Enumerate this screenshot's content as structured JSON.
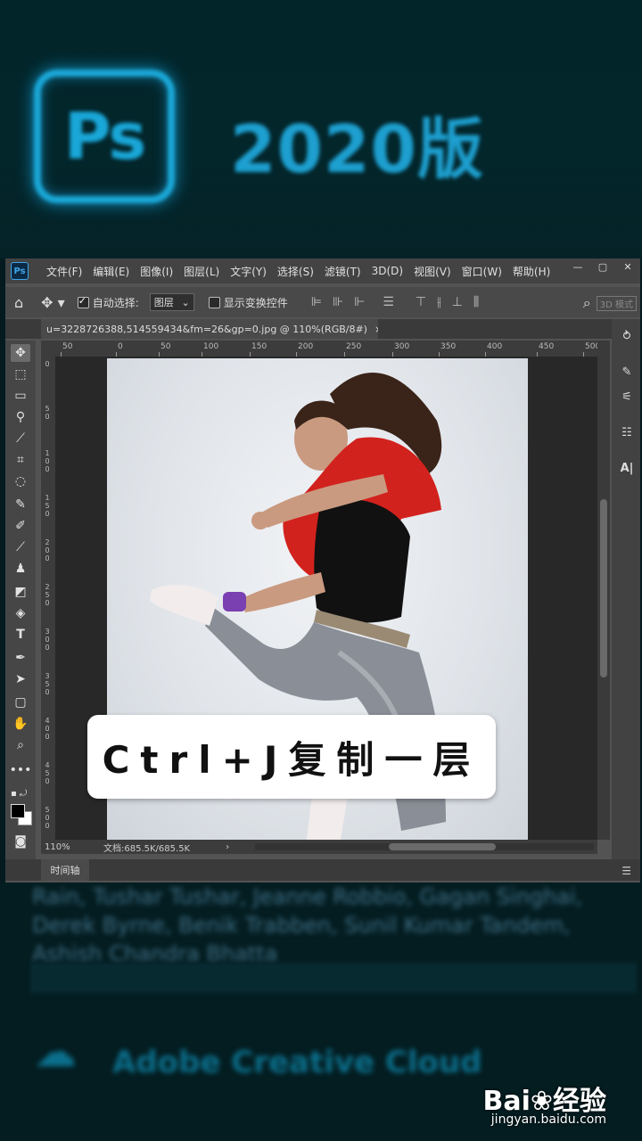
{
  "banner": {
    "logo_text": "Ps",
    "title": "2020版"
  },
  "menubar": {
    "app_icon": "Ps",
    "items": [
      "文件(F)",
      "编辑(E)",
      "图像(I)",
      "图层(L)",
      "文字(Y)",
      "选择(S)",
      "滤镜(T)",
      "3D(D)",
      "视图(V)",
      "窗口(W)",
      "帮助(H)"
    ],
    "window_controls": [
      "—",
      "▢",
      "✕"
    ]
  },
  "options_bar": {
    "auto_select_label": "自动选择:",
    "auto_select_checked": true,
    "layer_dropdown": "图层",
    "show_transform_label": "显示变换控件",
    "show_transform_checked": false,
    "mode_label": "3D 模式"
  },
  "document": {
    "tab_title": "u=3228726388,514559434&fm=26&gp=0.jpg @ 110%(RGB/8#)",
    "tab_close": "×",
    "zoom": "110%",
    "doc_size": "文档:685.5K/685.5K"
  },
  "rulers": {
    "top": [
      "50",
      "0",
      "50",
      "100",
      "150",
      "200",
      "250",
      "300",
      "350",
      "400",
      "450",
      "500"
    ],
    "left": [
      "0",
      "50",
      "100",
      "150",
      "200",
      "250",
      "300",
      "350",
      "400",
      "450",
      "500"
    ]
  },
  "tools": [
    "move-icon",
    "marquee-icon",
    "artboard-icon",
    "quick-select-icon",
    "eyedropper-icon",
    "crop-icon",
    "lasso-icon",
    "healing-icon",
    "clone-icon",
    "brush-icon",
    "stamp-icon",
    "eraser-icon",
    "paint-bucket-icon",
    "text-icon",
    "pen-icon",
    "path-select-icon",
    "shape-icon",
    "hand-icon",
    "zoom-icon",
    "more-icon"
  ],
  "timeline": {
    "tab": "时间轴"
  },
  "caption": {
    "text": "Ctrl+J复制一层"
  },
  "watermark": {
    "logo": "Bai❀经验",
    "url": "jingyan.baidu.com"
  },
  "bottom": {
    "credits": "Rain, Tushar Tushar, Jeanne Robbio, Gagan Singhai, Derek Byrne, Benik Trabben, Sunil Kumar Tandem, Ashish Chandra Bhatta",
    "cc_text": "Adobe Creative Cloud"
  }
}
